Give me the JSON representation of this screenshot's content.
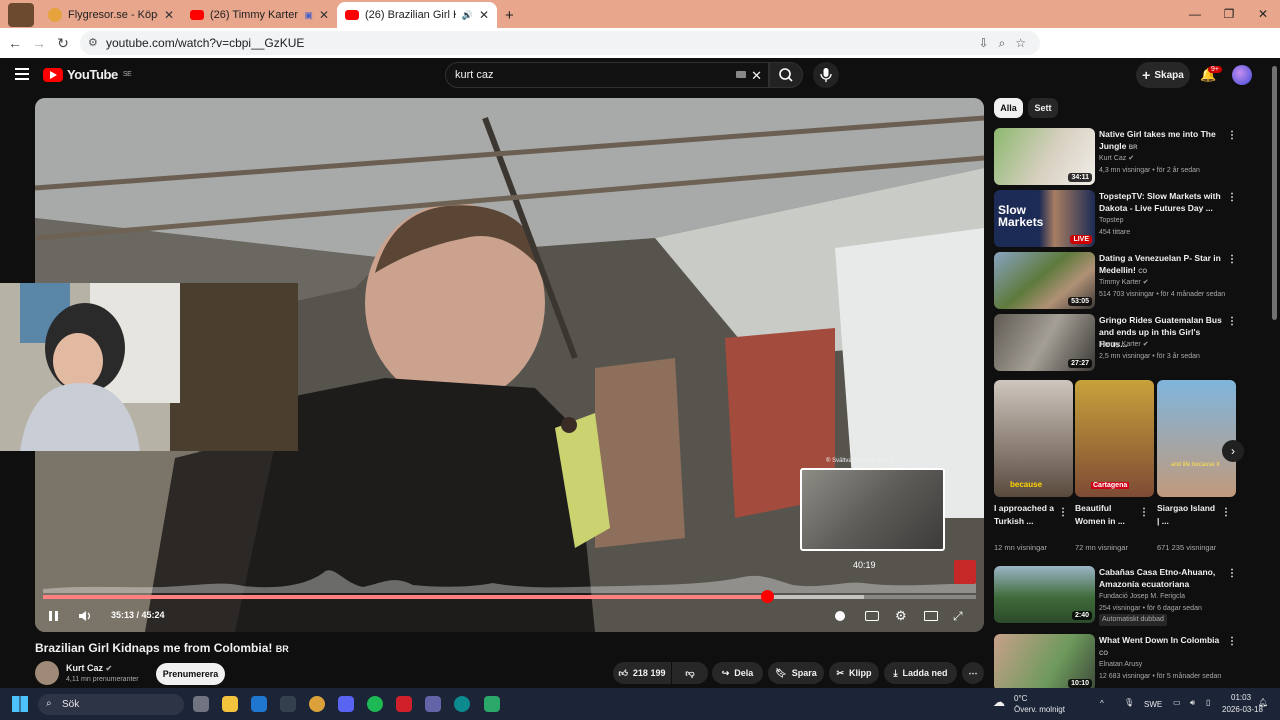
{
  "browser": {
    "tabs": [
      {
        "title": "Flygresor.se - Köpenhamn till B",
        "active": false
      },
      {
        "title": "(26) Timmy Karter - YouTub",
        "active": false
      },
      {
        "title": "(26) Brazilian Girl Kidnaps n",
        "active": true
      }
    ],
    "new_tab": "+",
    "url": "youtube.com/watch?v=cbpi__GzKUE"
  },
  "header": {
    "logo": "YouTube",
    "region": "SE",
    "search_value": "kurt caz",
    "create_label": "Skapa",
    "notifications": "9+"
  },
  "player": {
    "time_current": "35:13",
    "time_sep": " / ",
    "time_total": "45:24",
    "progress_fraction": 0.776,
    "buffer_fraction": 0.88,
    "hover_time": "40:19",
    "preview_caption": "® Svältvattnet i ett rum ut"
  },
  "video": {
    "title": "Brazilian Girl Kidnaps me from Colombia!",
    "title_badge": "BR",
    "channel": "Kurt Caz",
    "subscribers": "4,11 mn prenumeranter",
    "subscribe_label": "Prenumerera",
    "likes": "218 199",
    "share_label": "Dela",
    "save_label": "Spara",
    "clip_label": "Klipp",
    "download_label": "Ladda ned"
  },
  "sidebar": {
    "chips": [
      "Alla",
      "Sett"
    ],
    "videos": [
      {
        "title": "Native Girl takes me into The Jungle",
        "badge": "BR",
        "channel": "Kurt Caz",
        "meta": "4,3 mn visningar • för 2 år sedan",
        "duration": "34:11"
      },
      {
        "title": "TopstepTV: Slow Markets with Dakota - Live Futures Day ...",
        "channel": "Topstep",
        "meta": "454 tittare",
        "duration": "LIVE"
      },
      {
        "title": "Dating a Venezuelan P- Star in Medellin!",
        "badge": "CO",
        "channel": "Timmy Karter",
        "meta": "514 703 visningar • för 4 månader sedan",
        "duration": "53:05"
      },
      {
        "title": "Gringo Rides Guatemalan Bus and ends up in this Girl's Hous...",
        "channel": "Timmy Karter",
        "meta": "2,5 mn visningar • för 3 år sedan",
        "duration": "27:27"
      }
    ],
    "shorts": [
      {
        "title": "I approached a Turkish ...",
        "views": "12 mn visningar",
        "overlay": "because"
      },
      {
        "title": "Beautiful Women in ...",
        "views": "72 mn visningar",
        "overlay": "Cartagena"
      },
      {
        "title": "Siargao Island | ...",
        "views": "671 235 visningar",
        "overlay": "and life because it"
      }
    ],
    "videos2": [
      {
        "title": "Cabañas Casa Etno-Ahuano, Amazonía ecuatoriana",
        "channel": "Fundació Josep M. Ferigcla",
        "meta": "254 visningar • för 6 dagar sedan",
        "tag": "Automatiskt dubbad",
        "duration": "2:40"
      },
      {
        "title": "What Went Down In Colombia",
        "badge": "CO",
        "channel": "Elnatan Arusy",
        "meta": "12 683 visningar • för 5 månader sedan",
        "duration": "10:10"
      }
    ]
  },
  "taskbar": {
    "search_label": "Sök",
    "weather_temp": "0°C",
    "weather_text": "Överv. molnigt",
    "lang": "SWE",
    "time": "01:03",
    "date": "2026-03-18"
  }
}
